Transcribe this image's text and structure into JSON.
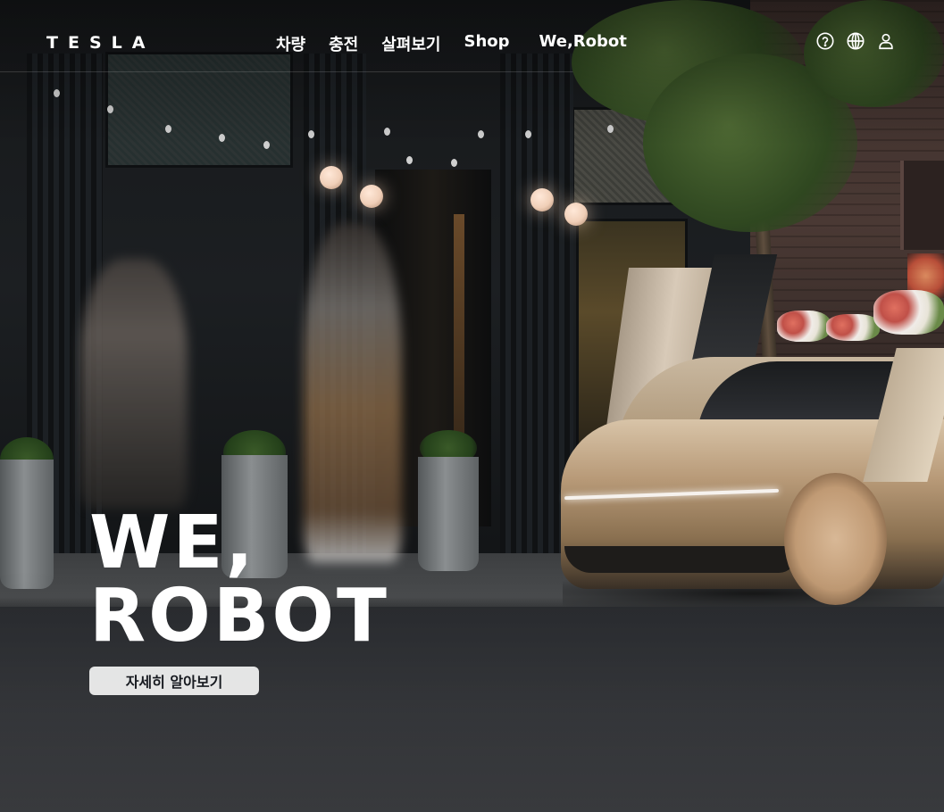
{
  "header": {
    "logo": "TESLA",
    "nav": [
      {
        "label": "차량"
      },
      {
        "label": "충전"
      },
      {
        "label": "살펴보기"
      },
      {
        "label": "Shop"
      },
      {
        "label": "We,Robot"
      }
    ],
    "utils": [
      {
        "icon": "help-icon"
      },
      {
        "icon": "globe-icon"
      },
      {
        "icon": "account-icon"
      }
    ]
  },
  "hero": {
    "headline_line1": "WE,",
    "headline_line2": "ROBOT",
    "cta_label": "자세히 알아보기"
  },
  "colors": {
    "text": "#ffffff",
    "cta_background": "#f4f4f4",
    "cta_text": "#171a20"
  }
}
